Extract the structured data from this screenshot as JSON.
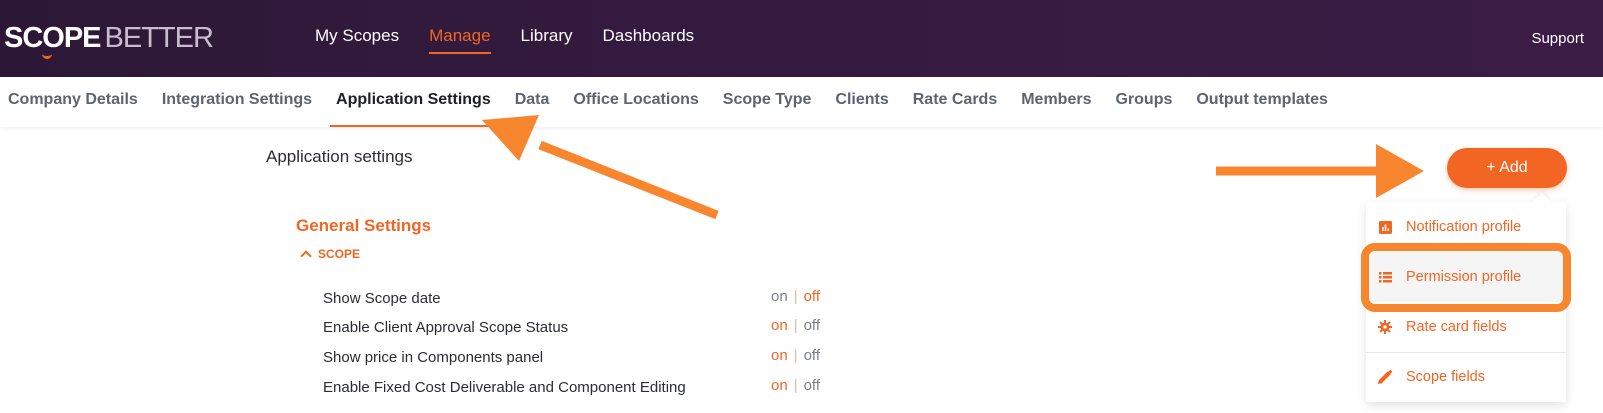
{
  "logo": {
    "part1": "SCOPE",
    "part2": "BETTER"
  },
  "topnav": {
    "items": [
      {
        "label": "My Scopes"
      },
      {
        "label": "Manage"
      },
      {
        "label": "Library"
      },
      {
        "label": "Dashboards"
      }
    ],
    "active": "Manage",
    "support": "Support"
  },
  "subnav": {
    "tabs": [
      {
        "label": "Company Details"
      },
      {
        "label": "Integration Settings"
      },
      {
        "label": "Application Settings"
      },
      {
        "label": "Data"
      },
      {
        "label": "Office Locations"
      },
      {
        "label": "Scope Type"
      },
      {
        "label": "Clients"
      },
      {
        "label": "Rate Cards"
      },
      {
        "label": "Members"
      },
      {
        "label": "Groups"
      },
      {
        "label": "Output templates"
      }
    ],
    "active": "Application Settings"
  },
  "main": {
    "title": "Application settings",
    "group_title": "General Settings",
    "scope_section": "SCOPE",
    "toggle_on": "on",
    "toggle_off": "off",
    "separator": "|",
    "settings": [
      {
        "label": "Show Scope date",
        "value": "off"
      },
      {
        "label": "Enable Client Approval Scope Status",
        "value": "on"
      },
      {
        "label": "Show price in Components panel",
        "value": "on"
      },
      {
        "label": "Enable Fixed Cost Deliverable and Component Editing",
        "value": "on"
      }
    ]
  },
  "add_menu": {
    "button_label": "+ Add",
    "items": [
      {
        "label": "Notification profile",
        "icon": "bar-chart-icon"
      },
      {
        "label": "Permission profile",
        "icon": "list-icon"
      },
      {
        "label": "Rate card fields",
        "icon": "gear-icon"
      },
      {
        "label": "Scope fields",
        "icon": "pencil-icon"
      }
    ]
  },
  "colors": {
    "accent": "#f26522",
    "annotation": "#f7862f",
    "topbar": "#361b40"
  }
}
